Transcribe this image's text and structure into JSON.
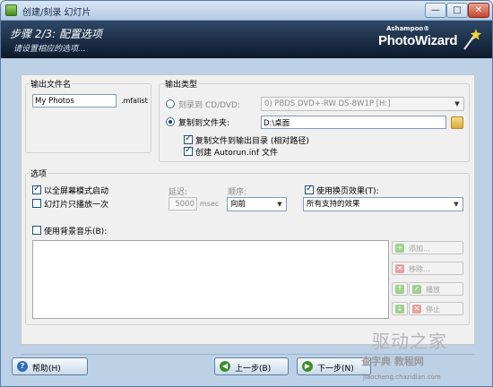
{
  "window": {
    "title": "创建/刻录 幻灯片",
    "min_glyph": "—",
    "max_glyph": "□",
    "close_glyph": "✕"
  },
  "header": {
    "step": "步骤 2/3: 配置选项",
    "subtitle": "请设置相应的选项...",
    "logo_brand": "Ashampoo®",
    "logo_product": "PhotoWizard"
  },
  "output_name": {
    "group_label": "输出文件名",
    "value": "My Photos",
    "extension": ".mfalist"
  },
  "output_type": {
    "group_label": "输出类型",
    "burn_label": "刻录到 CD/DVD:",
    "burn_selected": false,
    "drive_value": "0) PBDS DVD+-RW DS-8W1P [H:]",
    "copy_label": "复制到文件夹:",
    "copy_selected": true,
    "folder_value": "D:\\桌面",
    "copy_to_output_label": "复制文件到输出目录 (相对路径)",
    "copy_to_output_checked": true,
    "autorun_label": "创建 Autorun.inf 文件",
    "autorun_checked": true
  },
  "options": {
    "group_label": "选项",
    "fullscreen_label": "以全屏幕模式启动",
    "fullscreen_checked": true,
    "play_once_label": "幻灯片只播放一次",
    "play_once_checked": false,
    "delay_label": "延迟:",
    "delay_value": "5000",
    "delay_unit": "msec",
    "order_label": "顺序:",
    "order_value": "向前",
    "transition_label": "使用换页效果(T):",
    "transition_checked": true,
    "transition_value": "所有支持的效果",
    "music_label": "使用背景音乐(B):",
    "music_checked": false,
    "add_button": "添加...",
    "remove_button": "移除...",
    "play_button": "播放",
    "stop_button": "停止"
  },
  "nav": {
    "help": "帮助(H)",
    "back": "上一步(B)",
    "next": "下一步(N)"
  },
  "watermark": {
    "brand": "驱动之家",
    "site": "查字典 教程网",
    "url": "jiaocheng.chazidian.com"
  },
  "colors": {
    "accent": "#1a3d6e",
    "header_bg": "#14243a"
  }
}
